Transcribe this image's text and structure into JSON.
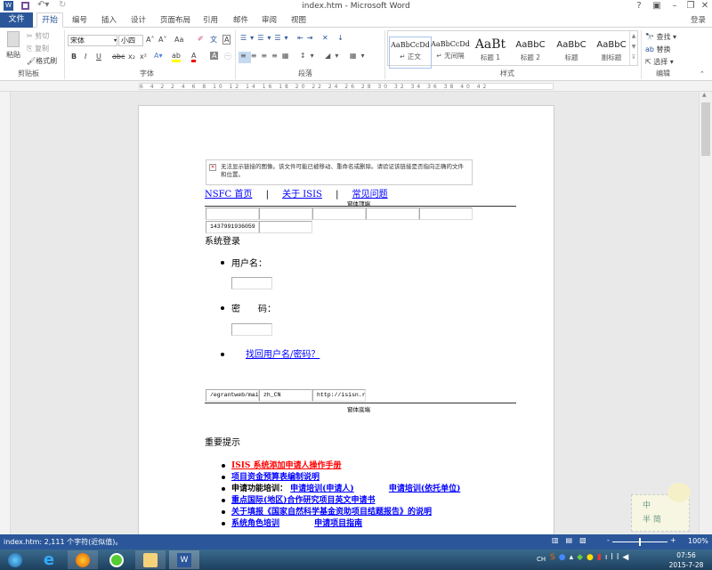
{
  "window": {
    "title": "index.htm - Microsoft Word",
    "help": "?",
    "signin": "登录"
  },
  "tabs": [
    "文件",
    "开始",
    "编号",
    "插入",
    "设计",
    "页面布局",
    "引用",
    "邮件",
    "审阅",
    "视图"
  ],
  "ribbon": {
    "clipboard": {
      "paste": "粘贴",
      "cut": "剪切",
      "copy": "复制",
      "format_painter": "格式刷",
      "group": "剪贴板"
    },
    "font": {
      "name": "宋体",
      "size": "小四",
      "group": "字体",
      "grow": "A˄",
      "shrink": "A˅",
      "case": "Aa",
      "bold": "B",
      "italic": "I",
      "underline": "U",
      "strike": "abc",
      "sub": "x₂",
      "sup": "x²"
    },
    "paragraph": {
      "group": "段落"
    },
    "styles": {
      "group": "样式",
      "items": [
        {
          "preview": "AaBbCcDd",
          "label": "↵ 正文"
        },
        {
          "preview": "AaBbCcDd",
          "label": "↵ 无间隔"
        },
        {
          "preview": "AaBt",
          "label": "标题 1"
        },
        {
          "preview": "AaBbC",
          "label": "标题 2"
        },
        {
          "preview": "AaBbC",
          "label": "标题"
        },
        {
          "preview": "AaBbC",
          "label": "副标题"
        }
      ]
    },
    "editing": {
      "find": "查找",
      "replace": "替换",
      "select": "选择",
      "group": "编辑"
    }
  },
  "ruler": "6 4 2 2 4 6 8 10 12 14 16 18 20 22 24 26 28 30 32 34 36 38 40 42",
  "doc": {
    "broken_image": "无法显示链接的图像。该文件可能已被移动、重命名或删除。请验证该链接是否指向正确的文件和位置。",
    "nav": [
      "NSFC 首页",
      "|",
      "关于 ISIS",
      "|",
      "常见问题"
    ],
    "form_top": "窗体顶端",
    "id_cell": "1437991936059",
    "login_heading": "系统登录",
    "username_label": "用户名：",
    "password_label": "密　　码：",
    "recover_link": "找回用户名/密码？",
    "hidden_cells": [
      "/egrantweb/mai",
      "zh_CN",
      "http://isisn.r"
    ],
    "form_bottom": "窗体底端",
    "notice_heading": "重要提示",
    "notices": [
      {
        "text": "ISIS 系统添加申请人操作手册",
        "color": "#ff0000"
      },
      {
        "text": "项目资金预算表编制说明"
      },
      {
        "prefix": "申请功能培训：",
        "links": [
          "申请培训(申请人)",
          "申请培训(依托单位)"
        ]
      },
      {
        "text": "重点国际(地区)合作研究项目英文申请书"
      },
      {
        "text": "关于填报《国家自然科学基金资助项目结题报告》的说明"
      },
      {
        "links": [
          "系统角色培训",
          "申请项目指南"
        ]
      }
    ]
  },
  "sticker": [
    "中",
    "半",
    "简"
  ],
  "status": {
    "text": "index.htm: 2,111 个字符(近似值)。",
    "zoom": "100%"
  },
  "taskbar": {
    "lang": "CH",
    "time": "07:56",
    "date": "2015-7-28"
  }
}
